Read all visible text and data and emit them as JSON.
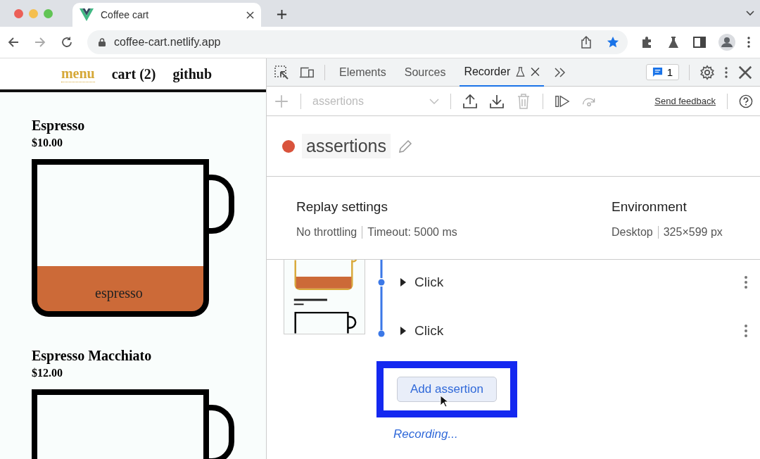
{
  "browser": {
    "tab_title": "Coffee cart",
    "url": "coffee-cart.netlify.app"
  },
  "site": {
    "nav": [
      {
        "label": "menu",
        "selected": true
      },
      {
        "label": "cart (2)",
        "selected": false
      },
      {
        "label": "github",
        "selected": false
      }
    ],
    "products": [
      {
        "name": "Espresso",
        "price": "$10.00",
        "label": "espresso"
      },
      {
        "name": "Espresso Macchiato",
        "price": "$12.00"
      }
    ]
  },
  "devtools": {
    "tabs": [
      {
        "label": "Elements",
        "selected": false
      },
      {
        "label": "Sources",
        "selected": false
      },
      {
        "label": "Recorder",
        "selected": true
      }
    ],
    "issues_count": "1",
    "recording_select": {
      "value": "assertions",
      "disabled": true
    },
    "send_feedback": "Send feedback",
    "recording_title": "assertions",
    "replay_settings": {
      "heading": "Replay settings",
      "items": [
        "No throttling",
        "Timeout: 5000 ms"
      ]
    },
    "environment": {
      "heading": "Environment",
      "items": [
        "Desktop",
        "325×599 px"
      ]
    },
    "steps": [
      {
        "label": "Click",
        "expanded": false
      },
      {
        "label": "Click",
        "expanded": false
      }
    ],
    "add_assertion": "Add assertion",
    "status": "Recording..."
  }
}
